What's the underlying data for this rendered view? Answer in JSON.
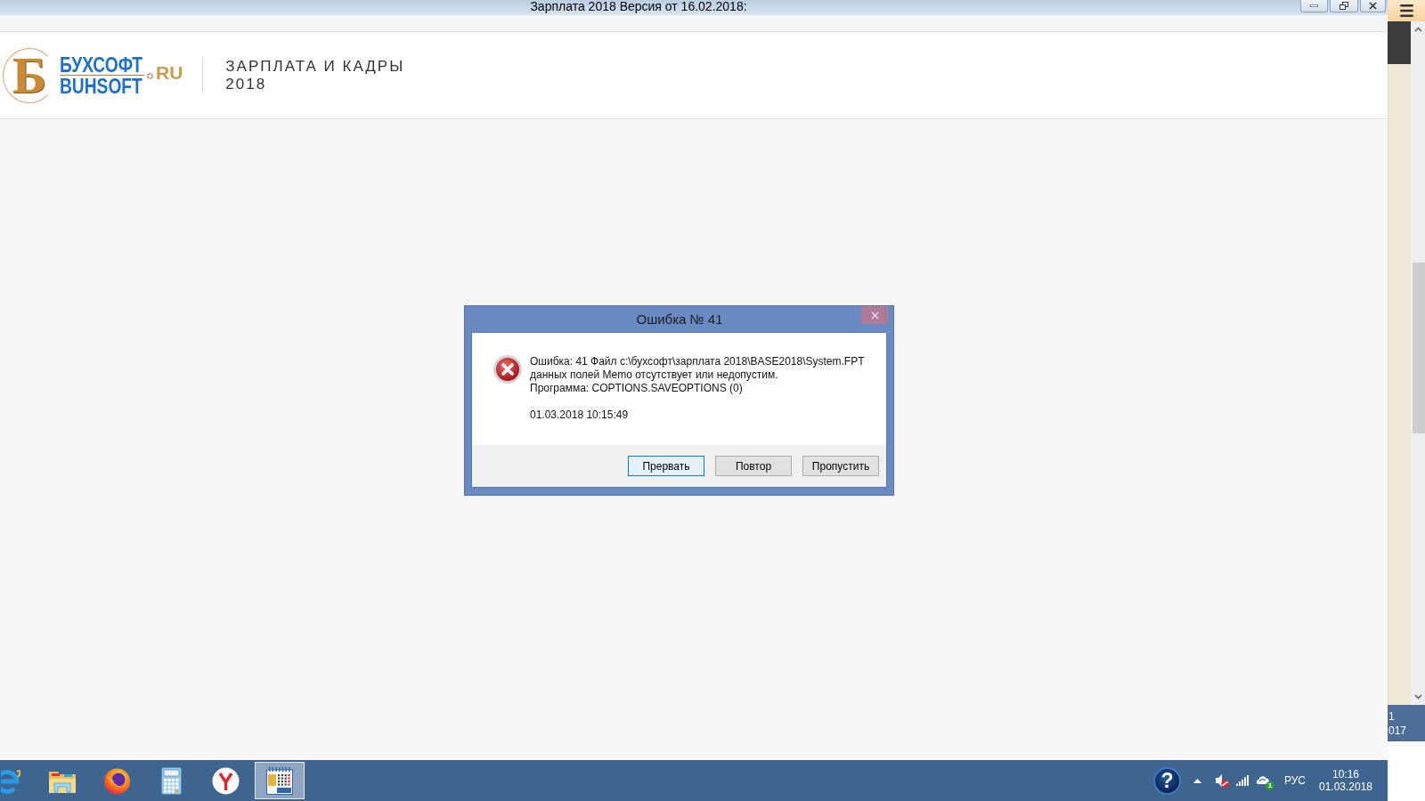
{
  "window": {
    "title": "Зарплата 2018 Версия от 16.02.2018:"
  },
  "header": {
    "logo": {
      "letter": "Б",
      "name_ru": "БУХСОФТ",
      "name_en": "BUHSOFT",
      "domain": "RU"
    },
    "product": {
      "title": "ЗАРПЛАТА И КАДРЫ",
      "year": "2018"
    }
  },
  "dialog": {
    "title": "Ошибка № 41",
    "kind": "error",
    "message_lines": [
      "Ошибка: 41 Файл c:\\бухсофт\\зарплата 2018\\BASE2018\\System.FPT",
      "данных полей Memo отсутствует или недопустим.",
      "Программа: COPTIONS.SAVEOPTIONS (0)"
    ],
    "timestamp": "01.03.2018 10:15:49",
    "buttons": [
      {
        "label": "Прервать",
        "focused": true
      },
      {
        "label": "Повтор",
        "focused": false
      },
      {
        "label": "Пропустить",
        "focused": false
      }
    ]
  },
  "taskbar": {
    "apps": [
      {
        "kind": "e_logo",
        "selected": false
      },
      {
        "kind": "folder",
        "selected": false
      },
      {
        "kind": "fox_globe",
        "selected": false
      },
      {
        "kind": "calculator",
        "selected": false
      },
      {
        "kind": "y_logo",
        "selected": false
      },
      {
        "kind": "calendar",
        "selected": true
      }
    ],
    "tray": {
      "help": "?",
      "sound_muted": true,
      "badge": "1",
      "language": "РУС",
      "time": "10:16",
      "date": "01.03.2018"
    }
  },
  "side_window": {
    "lines": [
      "1",
      "017"
    ]
  }
}
